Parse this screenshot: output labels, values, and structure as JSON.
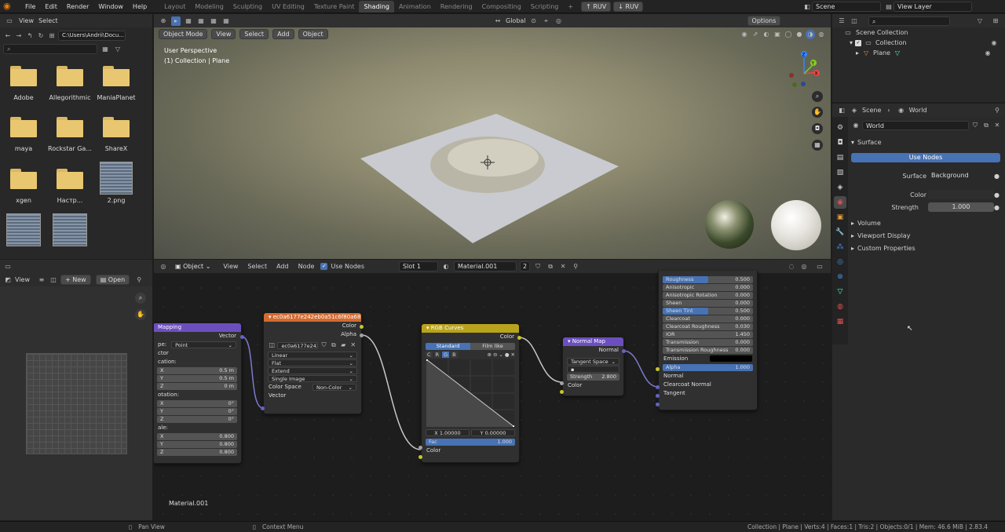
{
  "topbar": {
    "menu": [
      "File",
      "Edit",
      "Render",
      "Window",
      "Help"
    ],
    "workspaces": [
      "Layout",
      "Modeling",
      "Sculpting",
      "UV Editing",
      "Texture Paint",
      "Shading",
      "Animation",
      "Rendering",
      "Compositing",
      "Scripting"
    ],
    "active_workspace": "Shading",
    "addon_buttons": [
      "RUV",
      "RUV"
    ],
    "scene": "Scene",
    "view_layer": "View Layer"
  },
  "file_browser": {
    "menu": [
      "View",
      "Select"
    ],
    "path": "C:\\Users\\Andrii\\Docu...",
    "items": [
      {
        "label": "Adobe",
        "type": "folder"
      },
      {
        "label": "Allegorithmic",
        "type": "folder"
      },
      {
        "label": "ManiaPlanet",
        "type": "folder"
      },
      {
        "label": "maya",
        "type": "folder"
      },
      {
        "label": "Rockstar Ga...",
        "type": "folder"
      },
      {
        "label": "ShareX",
        "type": "folder"
      },
      {
        "label": "xgen",
        "type": "folder"
      },
      {
        "label": "Настр...",
        "type": "folder"
      },
      {
        "label": "2.png",
        "type": "image"
      }
    ]
  },
  "image_editor": {
    "view": "View",
    "new": "New",
    "open": "Open"
  },
  "viewport": {
    "header": {
      "mode": "Object Mode",
      "menu": [
        "View",
        "Select",
        "Add",
        "Object"
      ],
      "transform": "Global",
      "options": "Options"
    },
    "overlay_title": "User Perspective",
    "overlay_sub": "(1) Collection | Plane",
    "axis": {
      "x": "X",
      "y": "Y",
      "z": "Z"
    }
  },
  "node_editor": {
    "header": {
      "type": "Object",
      "menu": [
        "View",
        "Select",
        "Add",
        "Node"
      ],
      "use_nodes": "Use Nodes",
      "slot": "Slot 1",
      "material": "Material.001",
      "users": "2"
    },
    "material_label": "Material.001",
    "mapping": {
      "title": "Mapping",
      "vector_out": "Vector",
      "type_label": "pe:",
      "type": "Point",
      "vector": "ctor",
      "location": "cation:",
      "rotation": "otation:",
      "scale": "ale:",
      "loc": [
        {
          "a": "X",
          "v": "0.5 m"
        },
        {
          "a": "Y",
          "v": "0.5 m"
        },
        {
          "a": "Z",
          "v": "0 m"
        }
      ],
      "rot": [
        {
          "a": "X",
          "v": "0°"
        },
        {
          "a": "Y",
          "v": "0°"
        },
        {
          "a": "Z",
          "v": "0°"
        }
      ],
      "scl": [
        {
          "a": "X",
          "v": "0.800"
        },
        {
          "a": "Y",
          "v": "0.800"
        },
        {
          "a": "Z",
          "v": "0.800"
        }
      ]
    },
    "image_tex": {
      "title": "ec0a6177e242eb0a51c6f80a6880a451",
      "color": "Color",
      "alpha": "Alpha",
      "img": "ec0a6177e242e...",
      "interp": "Linear",
      "proj": "Flat",
      "ext": "Extend",
      "source": "Single Image",
      "cs_label": "Color Space",
      "cs": "Non-Color",
      "vector": "Vector"
    },
    "rgb_curves": {
      "title": "RGB Curves",
      "color_out": "Color",
      "tab1": "Standard",
      "tab2": "Film like",
      "channels": [
        "C",
        "R",
        "G",
        "B"
      ],
      "x": "X 1.00000",
      "y": "Y 0.00000",
      "fac_label": "Fac",
      "fac": "1.000",
      "color_in": "Color"
    },
    "normal_map": {
      "title": "Normal Map",
      "normal": "Normal",
      "space": "Tangent Space",
      "strength_label": "Strength",
      "strength": "2.800",
      "color": "Color"
    },
    "bsdf": {
      "rows": [
        {
          "l": "Roughness",
          "v": "0.500",
          "fill": 0.5
        },
        {
          "l": "Anisotropic",
          "v": "0.000",
          "fill": 0
        },
        {
          "l": "Anisotropic Rotation",
          "v": "0.000",
          "fill": 0
        },
        {
          "l": "Sheen",
          "v": "0.000",
          "fill": 0
        },
        {
          "l": "Sheen Tint",
          "v": "0.500",
          "fill": 0.5
        },
        {
          "l": "Clearcoat",
          "v": "0.000",
          "fill": 0
        },
        {
          "l": "Clearcoat Roughness",
          "v": "0.030",
          "fill": 0.03
        },
        {
          "l": "IOR",
          "v": "1.450",
          "fill": 0
        },
        {
          "l": "Transmission",
          "v": "0.000",
          "fill": 0
        },
        {
          "l": "Transmission Roughness",
          "v": "0.000",
          "fill": 0
        }
      ],
      "emission": "Emission",
      "alpha_label": "Alpha",
      "alpha": "1.000",
      "normal": "Normal",
      "clearcoat_normal": "Clearcoat Normal",
      "tangent": "Tangent"
    }
  },
  "outliner": {
    "scene_collection": "Scene Collection",
    "collection": "Collection",
    "plane": "Plane"
  },
  "properties": {
    "tabs": {
      "scene": "Scene",
      "world": "World"
    },
    "world_name": "World",
    "surface": "Surface",
    "use_nodes": "Use Nodes",
    "surface_label": "Surface",
    "surface_value": "Background",
    "color_label": "Color",
    "strength_label": "Strength",
    "strength": "1.000",
    "panels": [
      "Volume",
      "Viewport Display",
      "Custom Properties"
    ]
  },
  "statusbar": {
    "left": "Pan View",
    "mid": "Context Menu",
    "right": "Collection | Plane | Verts:4 | Faces:1 | Tris:2 | Objects:0/1 | Mem: 46.6 MiB | 2.83.4"
  },
  "colors": {
    "accent": "#4772b3",
    "mapping": "#6c4fbf",
    "tex": "#d36b2f",
    "curves": "#b8a31d",
    "normal": "#6c4fbf"
  }
}
